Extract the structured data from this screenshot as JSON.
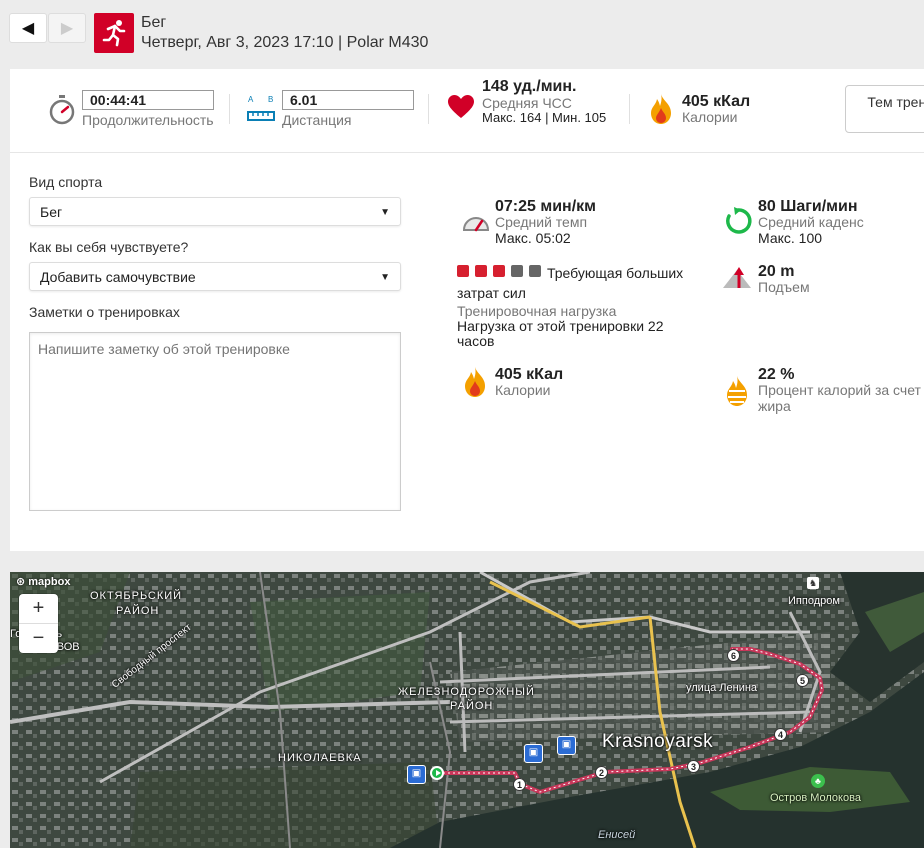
{
  "header": {
    "back_icon": "◀",
    "forward_icon": "▶",
    "sport_icon": "running-person-icon",
    "title": "Бег",
    "subtitle": "Четверг, Авг 3, 2023 17:10 | Polar M430"
  },
  "summary": {
    "duration_value": "00:44:41",
    "duration_label": "Продолжительность",
    "distance_ab": "A B",
    "distance_value": "6.01",
    "distance_label": "Дистанция",
    "hr_value": "148 уд./мин.",
    "hr_label": "Средняя ЧСС",
    "hr_sub": "Макс. 164  |  Мин. 105",
    "calories_value": "405 кКал",
    "calories_label": "Калории",
    "tag_button": "Тем трени"
  },
  "form": {
    "sport_label": "Вид спорта",
    "sport_value": "Бег",
    "feeling_label": "Как вы себя чувствуете?",
    "feeling_value": "Добавить самочувствие",
    "notes_label": "Заметки о тренировках",
    "notes_placeholder": "Напишите заметку об этой тренировке"
  },
  "stats": {
    "pace_value": "07:25 мин/км",
    "pace_label": "Средний темп",
    "pace_sub": "Макс. 05:02",
    "cadence_value": "80 Шаги/мин",
    "cadence_label": "Средний каденс",
    "cadence_sub": "Макс. 100",
    "load_text_1": "Требующая больших",
    "load_text_2": "затрат сил",
    "load_label": "Тренировочная нагрузка",
    "load_sub": "Нагрузка от этой тренировки 22 часов",
    "load_level": 3,
    "load_max": 5,
    "ascent_value": "20 m",
    "ascent_label": "Подъем",
    "cal_value": "405 кКал",
    "cal_label": "Калории",
    "fat_value": "22 %",
    "fat_label": "Процент калорий за счет жира"
  },
  "map": {
    "logo": "mapbox",
    "zoom_in": "+",
    "zoom_out": "−",
    "labels": {
      "district_1": "ОКТЯБРЬСКИЙ",
      "district_1b": "РАЙОН",
      "district_2": "ЖЕЛЕЗНОДОРОЖНЫЙ",
      "district_2b": "РАЙОН",
      "district_3": "НИКОЛАЕВКА",
      "city": "Krasnoyarsk",
      "street": "улица Ленина",
      "street_2": "Свободный проспект",
      "hippodrome": "Ипподром",
      "island": "Остров Молокова",
      "river": "Енисей",
      "memorial_1": "Го",
      "memorial_2": "ль",
      "memorial_3": "ам ВОВ"
    },
    "waypoints": [
      "1",
      "2",
      "3",
      "4",
      "5",
      "6"
    ]
  },
  "colors": {
    "brand": "#d10027",
    "load_active": "#d6202f",
    "load_inactive": "#666666",
    "route": "#c8375a"
  }
}
